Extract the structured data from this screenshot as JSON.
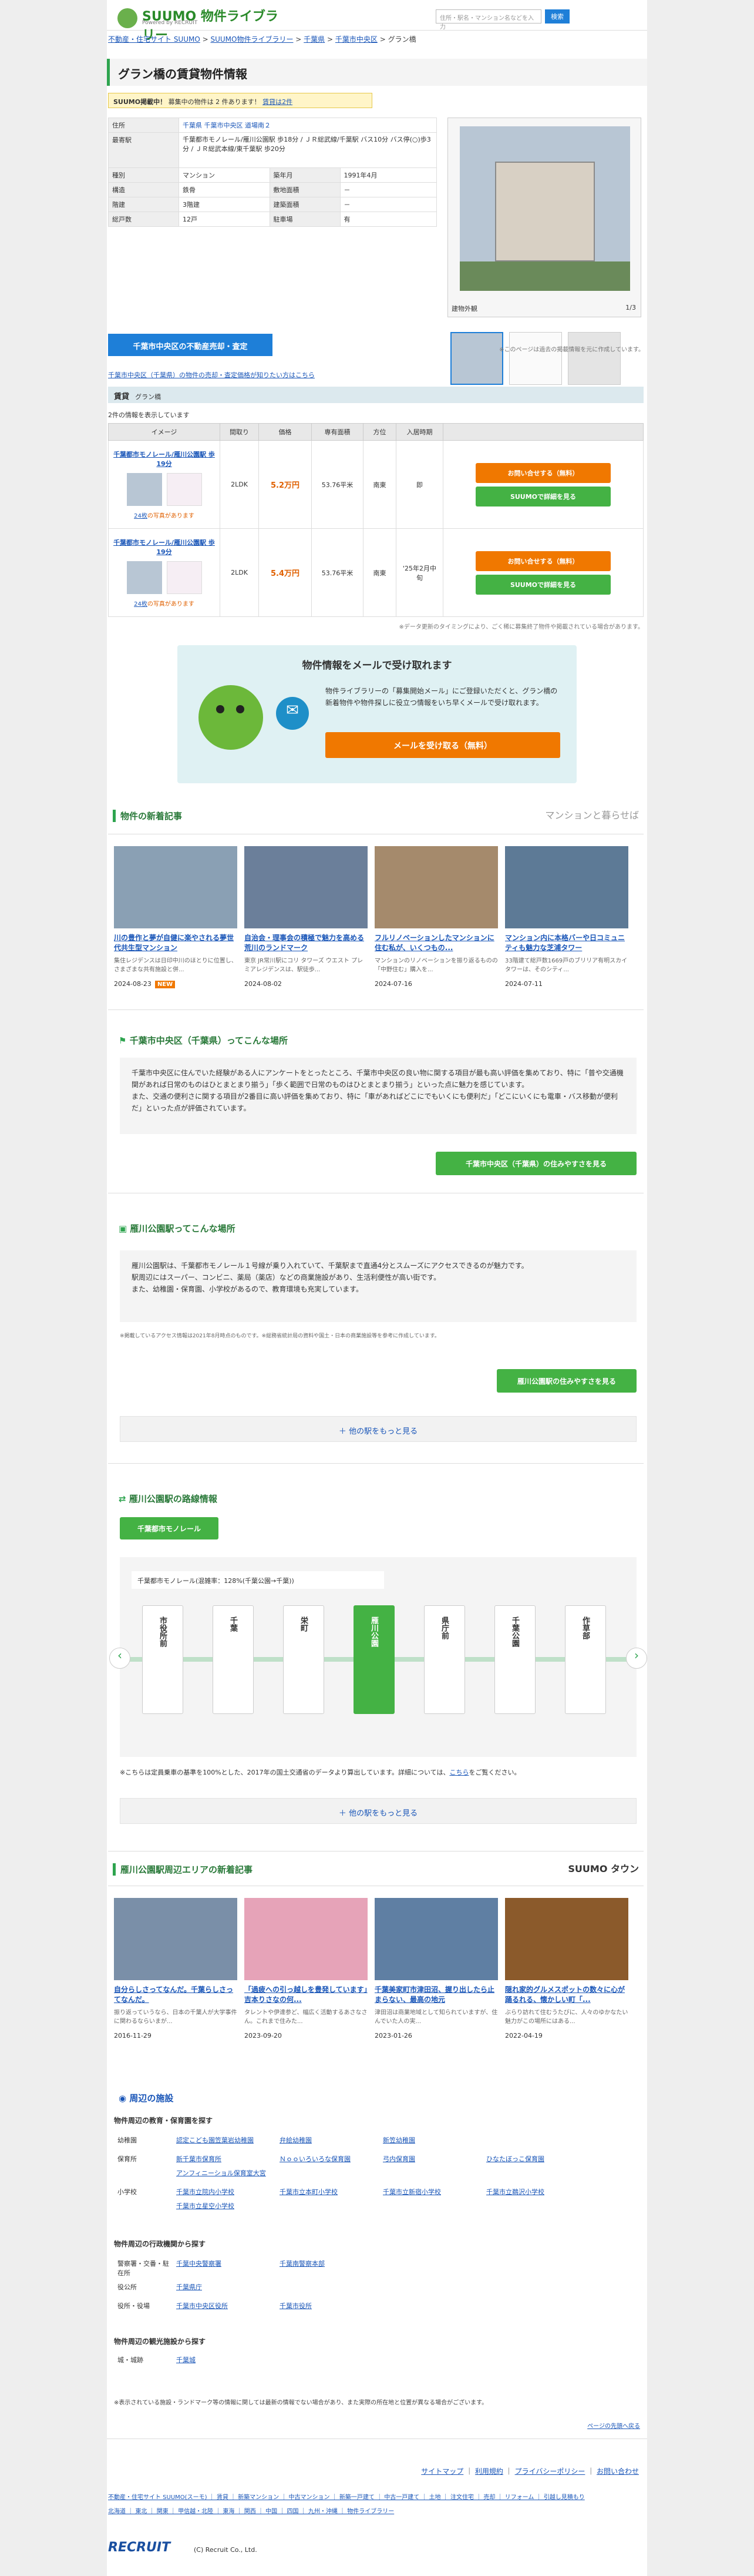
{
  "header": {
    "logo": "SUUMO 物件ライブラリー",
    "logo_sub": "Powered by RECRUIT",
    "search_placeholder": "住所・駅名・マンション名などを入力",
    "search_button": "検索"
  },
  "breadcrumb": [
    "不動産・住宅サイト SUUMO",
    "SUUMO物件ライブラリー",
    "千葉県",
    "千葉市中央区",
    "グラン橋"
  ],
  "title": "グラン橋の賃貸物件情報",
  "notice": {
    "label": "SUUMO掲載中！",
    "text": "募集中の物件は 2 件あります！",
    "link": "賃貸は2件"
  },
  "info": [
    {
      "k": "住所",
      "v": "千葉県 千葉市中央区 道場南２"
    },
    {
      "k": "最寄駅",
      "v": "千葉都市モノレール/雁川公園駅 歩18分 / ＪＲ総武線/千葉駅 バス10分 バス停(○)歩3分 / ＪＲ総武本線/東千葉駅 歩20分"
    },
    {
      "k": "種別",
      "v": "マンション",
      "k2": "築年月",
      "v2": "1991年4月"
    },
    {
      "k": "構造",
      "v": "鉄骨",
      "k2": "敷地面積",
      "v2": "－"
    },
    {
      "k": "階建",
      "v": "3階建",
      "k2": "建築面積",
      "v2": "－"
    },
    {
      "k": "総戸数",
      "v": "12戸",
      "k2": "駐車場",
      "v2": "有"
    }
  ],
  "photo": {
    "label": "建物外観",
    "counter": "1/3",
    "note": "※このページは過去の掲載情報を元に作成しています。"
  },
  "assess_btn": "千葉市中央区の不動産売却・査定",
  "assess_link": "千葉市中央区（千葉県）の物件の売却・査定価格が知りたい方はこちら",
  "rent": {
    "section": "賃貸",
    "building": "グラン橋",
    "count": "2件の情報を表示しています",
    "cols": [
      "イメージ",
      "間取り",
      "価格",
      "専有面積",
      "方位",
      "入居時期"
    ],
    "rows": [
      {
        "name": "千葉都市モノレール/雁川公園駅 歩19分",
        "photos": "24枚",
        "photos_suffix": "の写真があります",
        "layout": "2LDK",
        "price": "5.2万円",
        "area": "53.76平米",
        "dir": "南東",
        "move": "即",
        "btn1": "お問い合せする（無料）",
        "btn2": "SUUMOで詳細を見る"
      },
      {
        "name": "千葉都市モノレール/雁川公園駅 歩19分",
        "photos": "24枚",
        "photos_suffix": "の写真があります",
        "layout": "2LDK",
        "price": "5.4万円",
        "area": "53.76平米",
        "dir": "南東",
        "move": "'25年2月中旬",
        "btn1": "お問い合せする（無料）",
        "btn2": "SUUMOで詳細を見る"
      }
    ],
    "note": "※データ更新のタイミングにより、ごく稀に募集終了物件や掲載されている場合があります。"
  },
  "mail": {
    "title": "物件情報をメールで受け取れます",
    "text": "物件ライブラリーの「募集開始メール」にご登録いただくと、グラン橋の新着物件や物件探しに役立つ情報をいち早くメールで受け取れます。",
    "btn": "メールを受け取る（無料）"
  },
  "articles1": {
    "title": "物件の新着記事",
    "brand": "マンションと暮らせば",
    "items": [
      {
        "t": "川の豊作と夢が自健に楽やされる夢世代共生型マンション",
        "s": "集住レジデンスは日印中川のほとりに位置し、さまざまな共有施設と併...",
        "d": "2024-08-23",
        "new": "NEW",
        "color": "#8aa0b4"
      },
      {
        "t": "自治会・理事会の積極で魅力を高める荒川のランドマーク",
        "s": "東京 JR常川駅にコリ タワーズ ウエスト プレミアレジデンスは、駅徒歩...",
        "d": "2024-08-02",
        "new": "",
        "color": "#6b7f9a"
      },
      {
        "t": "フルリノベーションしたマンションに住む私が、いくつもの...",
        "s": "マンションのリノベーションを振り返るものの「中野住む」購入を...",
        "d": "2024-07-16",
        "new": "",
        "color": "#a58a6c"
      },
      {
        "t": "マンション内に本格バーや日コミュニティも魅力な芝浦タワー",
        "s": "33階建て総戸数1669戸のブリリア有明スカイタワーは、そのシティ...",
        "d": "2024-07-11",
        "new": "",
        "color": "#5d7a96"
      }
    ]
  },
  "area1": {
    "title": "千葉市中央区（千葉県）ってこんな場所",
    "text": "千葉市中央区に住んでいた経験がある人にアンケートをとったところ、千葉市中央区の良い物に関する項目が最も高い評価を集めており、特に「普や交通機関があれば日常のものはひとまとまり揃う」「歩く範囲で日常のものはひとまとまり揃う」といった点に魅力を感じています。\nまた、交通の便利さに関する項目が2番目に高い評価を集めており、特に「車があればどこにでもいくにも便利だ」「どこにいくにも電車・バス移動が便利だ」といった点が評価されています。",
    "btn": "千葉市中央区（千葉県）の住みやすさを見る"
  },
  "area2": {
    "title": "雁川公園駅ってこんな場所",
    "text": "雁川公園駅は、千葉都市モノレール１号線が乗り入れていて、千葉駅まで直通4分とスムーズにアクセスできるのが魅力です。\n駅周辺にはスーパー、コンビニ、薬局（薬店）などの商業施設があり、生活利便性が高い街です。\nまた、幼稚園・保育園、小学校があるので、教育環境も充実しています。",
    "note": "※掲載しているアクセス情報は2021年8月時点のものです。※総務省統計局の資料や国土・日本の商業施設等を参考に作成しています。",
    "btn": "雁川公園駅の住みやすさを見る",
    "more": "他の駅をもっと見る"
  },
  "line": {
    "title": "雁川公園駅の路線情報",
    "tab": "千葉都市モノレール",
    "label": "千葉都市モノレール(混雑率：128%(千葉公園→千葉))",
    "stations": [
      "市役所前",
      "千葉",
      "栄町",
      "雁川公園",
      "県庁前",
      "千葉公園",
      "作草部"
    ],
    "note": "※こちらは定員乗車の基準を100%とした、2017年の国土交通省のデータより算出しています。詳細については、",
    "note_link": "こちら",
    "note_end": "をご覧ください。",
    "more": "他の駅をもっと見る"
  },
  "articles2": {
    "title": "雁川公園駅周辺エリアの新着記事",
    "brand": "SUUMO タウン",
    "items": [
      {
        "t": "自分らしさってなんだ。千葉らしさってなんだ。",
        "s": "振り返っていうなら、日本の千葉人が大学事件に関わるならいまが...",
        "d": "2016-11-29",
        "color": "#7a8fa8"
      },
      {
        "t": "「過疲への引っ越しを豊発しています」吉本りさなの何...",
        "s": "タレントや伊達参ど、幅広く活動するあさなさん。これまで住みた...",
        "d": "2023-09-20",
        "color": "#e6a3b8"
      },
      {
        "t": "千葉美家町市津田沼、握り出したら止まらない、最高の地元",
        "s": "津田沼は商業地域として知られていますが、住んでいた人の実...",
        "d": "2023-01-26",
        "color": "#5f7fa3"
      },
      {
        "t": "隠れ家的グルメスポットの数々に心が踊るれる、懐かしい町「...",
        "s": "ぶらり訪れて住むうたびに、人々のゆかなたい魅力がこの場所にはある...",
        "d": "2022-04-19",
        "color": "#8b5a2b"
      }
    ]
  },
  "facilities": {
    "title": "周辺の施設",
    "edu_title": "物件周辺の教育・保育園を探す",
    "edu": [
      {
        "k": "幼稚園",
        "v": [
          "認定こども園笠葉岩幼稚園",
          "弁絵幼稚園",
          "新笠幼稚園"
        ]
      },
      {
        "k": "保育所",
        "v": [
          "新千葉市保育所",
          "Ｎｏｏいろいろな保育園",
          "弓内保育園",
          "ひなたぼっこ保育園",
          "アンフィニーショル保育室大宮"
        ]
      },
      {
        "k": "小学校",
        "v": [
          "千葉市立院内小学校",
          "千葉市立本町小学校",
          "千葉市立新宿小学校",
          "千葉市立鵜沢小学校",
          "千葉市立星空小学校"
        ]
      }
    ],
    "admin_title": "物件周辺の行政機関から探す",
    "admin": [
      {
        "k": "警察署・交番・駐在所",
        "v": [
          "千葉中央警察署",
          "千葉南警察本部"
        ]
      },
      {
        "k": "役公所",
        "v": [
          "千葉県庁"
        ]
      },
      {
        "k": "役所・役場",
        "v": [
          "千葉市中央区役所",
          "千葉市役所"
        ]
      }
    ],
    "sight_title": "物件周辺の観光施設から探す",
    "sight": [
      {
        "k": "城・城跡",
        "v": [
          "千葉城"
        ]
      }
    ],
    "note": "※表示されている施設・ランドマーク等の情報に関しては最新の情報でない場合があり、また実際の所在地と位置が異なる場合がございます。",
    "top": "ページの先頭へ戻る"
  },
  "footer": {
    "links": [
      "サイトマップ",
      "利用規約",
      "プライバシーポリシー",
      "お問い合わせ"
    ],
    "line1": "不動産・住宅サイト SUUMO(スーモ) ｜ 賃貸 ｜ 新築マンション ｜ 中古マンション ｜ 新築一戸建て ｜ 中古一戸建て ｜ 土地 ｜ 注文住宅 ｜ 売却 ｜ リフォーム ｜ 引越し見積もり",
    "line2": "北海道 ｜ 東北 ｜ 関東 ｜ 甲信越・北陸 ｜ 東海 ｜ 関西 ｜ 中国 ｜ 四国 ｜ 九州・沖縄 ｜ 物件ライブラリー",
    "copy": "(C) Recruit Co., Ltd.",
    "brand": "RECRUIT"
  }
}
